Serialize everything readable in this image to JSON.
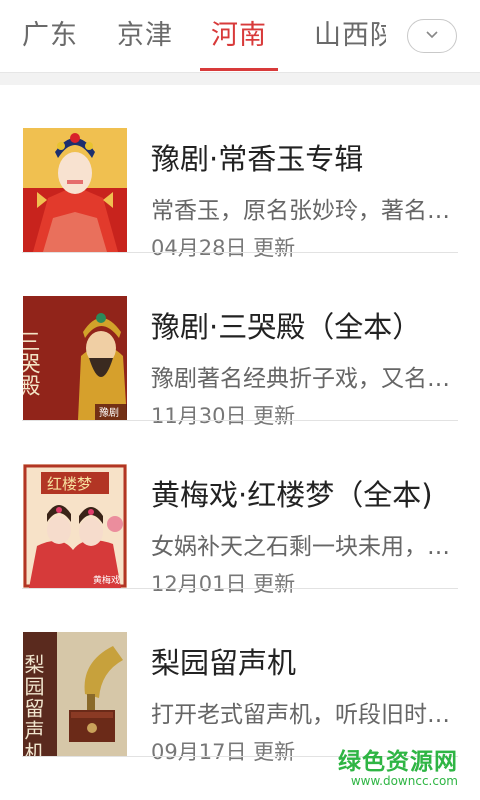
{
  "tabs": [
    {
      "label": "广东",
      "active": false
    },
    {
      "label": "京津",
      "active": false
    },
    {
      "label": "河南",
      "active": true
    },
    {
      "label": "山西陕",
      "active": false
    }
  ],
  "dropdown_icon": "chevron-down-icon",
  "items": [
    {
      "title": "豫剧·常香玉专辑",
      "desc": "常香玉，原名张妙玲，著名豫剧表演艺术家",
      "updated": "04月28日 更新",
      "thumb_text": ""
    },
    {
      "title": "豫剧·三哭殿（全本）",
      "desc": "豫剧著名经典折子戏，又名秦雪梅吊孝",
      "updated": "11月30日 更新",
      "thumb_text": "三哭殿",
      "thumb_tag": "豫剧"
    },
    {
      "title": "黄梅戏·红楼梦（全本)",
      "desc": "女娲补天之石剩一块未用，弃在青埂峰下",
      "updated": "12月01日 更新",
      "thumb_text": "红楼梦",
      "thumb_tag": "黄梅戏"
    },
    {
      "title": "梨园留声机",
      "desc": "打开老式留声机，听段旧时戏曲唱片",
      "updated": "09月17日 更新",
      "thumb_text": "梨园留声机"
    }
  ],
  "watermark": {
    "main": "绿色资源网",
    "url": "www.downcc.com"
  },
  "colors": {
    "accent": "#d83a3a",
    "watermark": "#2fb544"
  }
}
